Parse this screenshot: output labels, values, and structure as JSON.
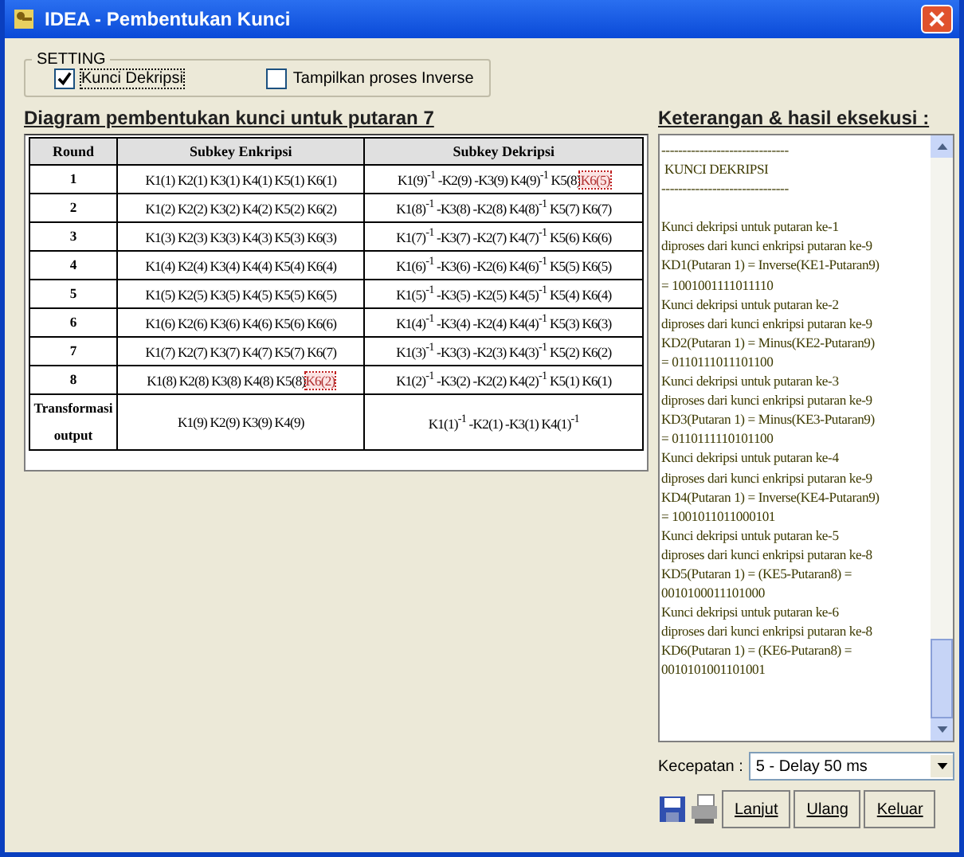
{
  "window": {
    "title": "IDEA - Pembentukan Kunci"
  },
  "setting": {
    "legend": "SETTING",
    "options": [
      {
        "label": "Kunci Dekripsi",
        "checked": true
      },
      {
        "label": "Tampilkan proses Inverse",
        "checked": false
      }
    ]
  },
  "diagram": {
    "heading": "Diagram pembentukan kunci untuk putaran 7",
    "columns": [
      "Round",
      "Subkey Enkripsi",
      "Subkey Dekripsi"
    ],
    "rows": [
      {
        "round": "1",
        "enc": {
          "text": "K1(1) K2(1) K3(1) K4(1) K5(1) K6(1)"
        },
        "dec": {
          "text": "K1(9)$^{-1}$ -K2(9) -K3(9) K4(9)$^{-1}$ K5(8)",
          "highlight": "K6(5)"
        }
      },
      {
        "round": "2",
        "enc": {
          "text": "K1(2) K2(2) K3(2) K4(2) K5(2) K6(2)"
        },
        "dec": {
          "text": "K1(8)$^{-1}$ -K3(8) -K2(8) K4(8)$^{-1}$ K5(7) K6(7)"
        }
      },
      {
        "round": "3",
        "enc": {
          "text": "K1(3) K2(3) K3(3) K4(3) K5(3) K6(3)"
        },
        "dec": {
          "text": "K1(7)$^{-1}$ -K3(7) -K2(7) K4(7)$^{-1}$ K5(6) K6(6)"
        }
      },
      {
        "round": "4",
        "enc": {
          "text": "K1(4) K2(4) K3(4) K4(4) K5(4) K6(4)"
        },
        "dec": {
          "text": "K1(6)$^{-1}$ -K3(6) -K2(6) K4(6)$^{-1}$ K5(5) K6(5)"
        }
      },
      {
        "round": "5",
        "enc": {
          "text": "K1(5) K2(5) K3(5) K4(5) K5(5) K6(5)"
        },
        "dec": {
          "text": "K1(5)$^{-1}$ -K3(5) -K2(5) K4(5)$^{-1}$ K5(4) K6(4)"
        }
      },
      {
        "round": "6",
        "enc": {
          "text": "K1(6) K2(6) K3(6) K4(6) K5(6) K6(6)"
        },
        "dec": {
          "text": "K1(4)$^{-1}$ -K3(4) -K2(4) K4(4)$^{-1}$ K5(3) K6(3)"
        }
      },
      {
        "round": "7",
        "enc": {
          "text": "K1(7) K2(7) K3(7) K4(7) K5(7) K6(7)"
        },
        "dec": {
          "text": "K1(3)$^{-1}$ -K3(3) -K2(3) K4(3)$^{-1}$ K5(2) K6(2)"
        }
      },
      {
        "round": "8",
        "enc": {
          "text": "K1(8) K2(8) K3(8) K4(8) K5(8)",
          "highlight": "K6(2)"
        },
        "dec": {
          "text": "K1(2)$^{-1}$ -K3(2) -K2(2) K4(2)$^{-1}$ K5(1) K6(1)"
        }
      },
      {
        "round": "Transformasi output",
        "enc": {
          "text": "K1(9) K2(9) K3(9) K4(9)"
        },
        "dec": {
          "text": "K1(1)$^{-1}$ -K2(1) -K3(1) K4(1)$^{-1}$"
        }
      }
    ]
  },
  "log": {
    "heading": "Keterangan & hasil eksekusi :",
    "header": [
      "------------------------------",
      " KUNCI DEKRIPSI",
      "------------------------------"
    ],
    "lines": [
      "Kunci dekripsi untuk putaran ke-1",
      "diproses dari kunci enkripsi putaran ke-9",
      "KD1(Putaran 1) = Inverse(KE1-Putaran9)",
      "= 1001001111011110",
      "Kunci dekripsi untuk putaran ke-2",
      "diproses dari kunci enkripsi putaran ke-9",
      "KD2(Putaran 1) = Minus(KE2-Putaran9)",
      "= 0110111011101100",
      "Kunci dekripsi untuk putaran ke-3",
      "diproses dari kunci enkripsi putaran ke-9",
      "KD3(Putaran 1) = Minus(KE3-Putaran9)",
      "= 0110111110101100",
      "Kunci dekripsi untuk putaran ke-4",
      "diproses dari kunci enkripsi putaran ke-9",
      "KD4(Putaran 1) = Inverse(KE4-Putaran9)",
      "= 1001011011000101",
      "Kunci dekripsi untuk putaran ke-5",
      "diproses dari kunci enkripsi putaran ke-8",
      "KD5(Putaran 1) = (KE5-Putaran8) =",
      "0010100011101000",
      "Kunci dekripsi untuk putaran ke-6",
      "diproses dari kunci enkripsi putaran ke-8",
      "KD6(Putaran 1) = (KE6-Putaran8) =",
      "0010101001101001"
    ]
  },
  "speed": {
    "label": "Kecepatan :",
    "value": "5 - Delay 50 ms"
  },
  "buttons": [
    "Lanjut",
    "Ulang",
    "Keluar"
  ]
}
